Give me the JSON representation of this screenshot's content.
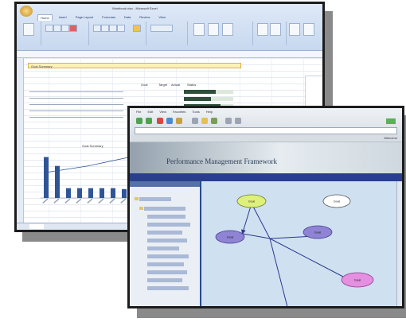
{
  "excel": {
    "title": "Workbook.xlsx - Microsoft Excel",
    "tabs": [
      "Home",
      "Insert",
      "Page Layout",
      "Formulas",
      "Data",
      "Review",
      "View"
    ],
    "banner_text": "Goal Summary",
    "table_headers": [
      "Goal",
      "Target",
      "Actual",
      "Status"
    ],
    "chart_title": "Goal Summary",
    "bars": [
      92,
      72,
      22,
      22,
      22,
      22,
      22,
      20,
      20
    ]
  },
  "perf": {
    "menu": [
      "File",
      "Edit",
      "View",
      "Favorites",
      "Tools",
      "Help"
    ],
    "login_text": "Welcome",
    "subtitle": "",
    "title": "Performance Management Framework",
    "crumb": "",
    "nodes": [
      {
        "label": "Goal",
        "color": "#dff07a"
      },
      {
        "label": "Goal",
        "color": "#ffffff"
      },
      {
        "label": "Goal",
        "color": "#8f83d6"
      },
      {
        "label": "Goal",
        "color": "#8f83d6"
      },
      {
        "label": "Goal",
        "color": "#e48fe0"
      }
    ]
  }
}
